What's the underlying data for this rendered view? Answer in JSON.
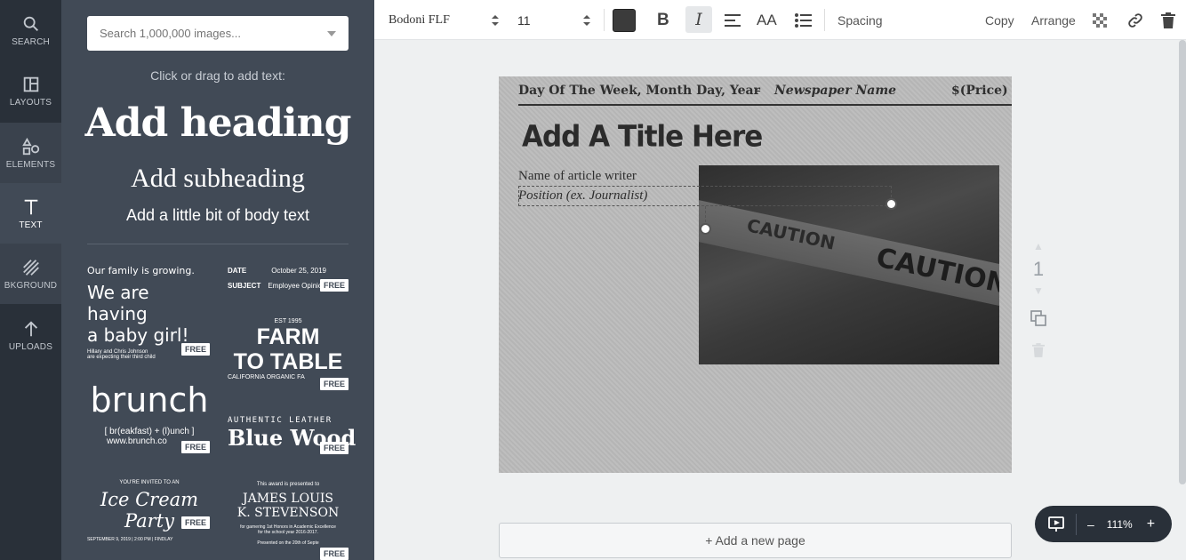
{
  "rail": {
    "items": [
      {
        "label": "SEARCH",
        "icon": "search-icon"
      },
      {
        "label": "LAYOUTS",
        "icon": "layouts-icon"
      },
      {
        "label": "ELEMENTS",
        "icon": "elements-icon"
      },
      {
        "label": "TEXT",
        "icon": "text-icon",
        "active": true
      },
      {
        "label": "BKGROUND",
        "icon": "background-icon"
      },
      {
        "label": "UPLOADS",
        "icon": "upload-icon"
      }
    ]
  },
  "panel": {
    "search_placeholder": "Search 1,000,000 images...",
    "hint": "Click or drag to add text:",
    "add_heading": "Add heading",
    "add_subheading": "Add subheading",
    "add_body": "Add a little bit of body text",
    "free_badge": "FREE",
    "templates": {
      "baby": {
        "line1": "Our family is growing.",
        "line2": "We are having",
        "line3": "a baby girl!",
        "line4": "Hillary and Chris Johnson",
        "line5": "are expecting their third child"
      },
      "memo": {
        "date_label": "DATE",
        "date_value": "October 25, 2019",
        "subject_label": "SUBJECT",
        "subject_value": "Employee Opinio"
      },
      "farm": {
        "est": "EST 1995",
        "line1": "FARM",
        "line2": "TO TABLE",
        "line3": "CALIFORNIA ORGANIC FA"
      },
      "brunch": {
        "title": "brunch",
        "line1": "[ br(eakfast) + (l)unch ]",
        "line2": "www.brunch.co"
      },
      "leather": {
        "line1": "AUTHENTIC LEATHER",
        "line2": "Blue Wood"
      },
      "icecream": {
        "line1": "YOU'RE INVITED TO AN",
        "line2": "Ice Cream Party",
        "line3": "SEPTEMBER 9, 2019 | 2:00 PM | FINDLAY"
      },
      "award": {
        "line1": "This award is presented to",
        "line2": "JAMES LOUIS",
        "line3": "K. STEVENSON",
        "line4": "for garnering 1st Honors in Academic Excellence",
        "line5": "for the school year 2016-2017.",
        "line6": "Presented on the 20th of Septe"
      }
    }
  },
  "toolbar": {
    "font_name": "Bodoni FLF",
    "font_size": "11",
    "text_color": "#3b3b3b",
    "bold_label": "B",
    "italic_label": "I",
    "case_label": "AA",
    "spacing_label": "Spacing",
    "copy_label": "Copy",
    "arrange_label": "Arrange"
  },
  "canvas": {
    "header_date": "Day Of The Week, Month Day, Year",
    "header_dash": "-",
    "header_name": "Newspaper Name",
    "header_price": "$(Price)",
    "title": "Add A Title Here",
    "writer": "Name of article writer",
    "position": "Position (ex. Journalist)",
    "tape_word1": "CAUTION",
    "tape_word2": "CAUTION",
    "page_number": "1"
  },
  "add_page_label": "+ Add a new page",
  "zoom": {
    "minus": "–",
    "value": "111%",
    "plus": "+"
  }
}
